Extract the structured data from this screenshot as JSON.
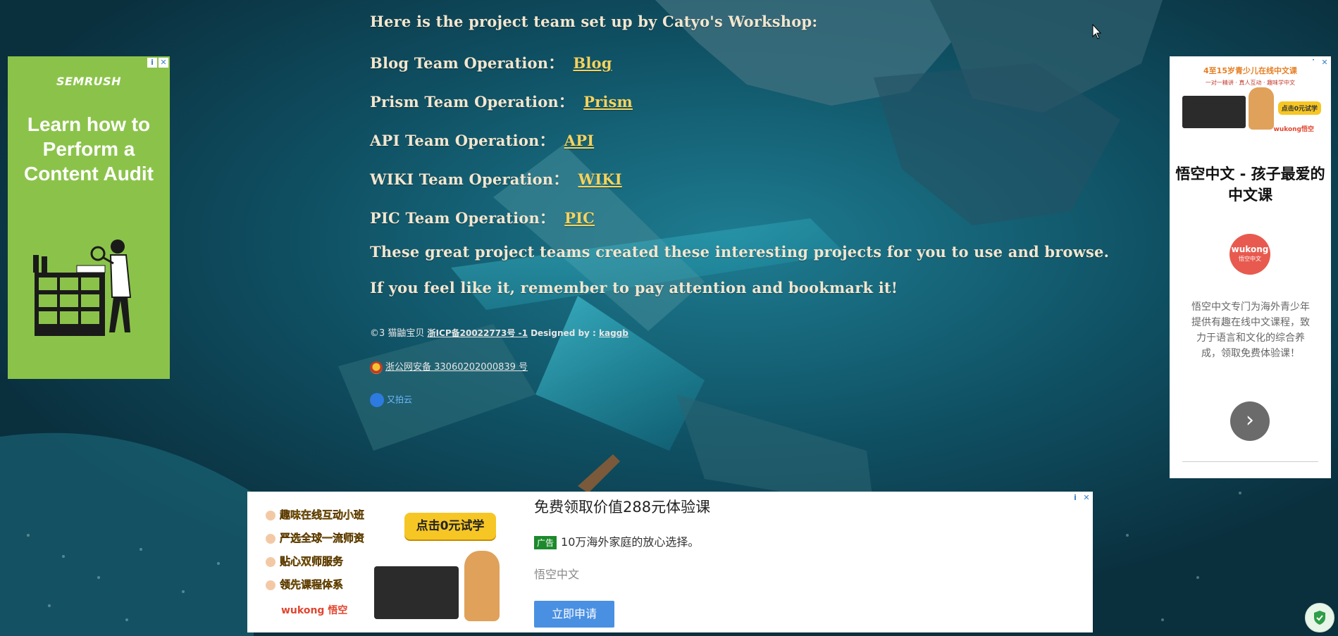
{
  "main": {
    "intro": "Here is the project team set up by Catyo's Workshop:",
    "teams": [
      {
        "label": "Blog Team Operation：",
        "link": "Blog"
      },
      {
        "label": "Prism Team Operation：",
        "link": "Prism"
      },
      {
        "label": "API Team Operation：",
        "link": "API"
      },
      {
        "label": "WIKI Team Operation：",
        "link": "WIKI"
      },
      {
        "label": "PIC Team Operation：",
        "link": "PIC"
      }
    ],
    "outro1": "These great project teams created these interesting projects for you to use and browse.",
    "outro2": "If you feel like it, remember to pay attention and bookmark it!"
  },
  "footer": {
    "copyright": "©3 猫鼬宝贝",
    "icp": "浙ICP备20022773号 -1",
    "designed_label": "Designed by :",
    "designer": "kaggb",
    "police": "浙公网安备 33060202000839 号",
    "cloud": "又拍云"
  },
  "ads": {
    "left": {
      "brand": "SEMRUSH",
      "headline": "Learn how to Perform a Content Audit"
    },
    "right": {
      "title": "悟空中文 - 孩子最爱的中文课",
      "logo_text": "wukong",
      "logo_sub": "悟空中文",
      "banner_top": "4至15岁青少儿在线中文课",
      "banner_tag": "一对一精讲 · 真人互动 · 趣味学中文",
      "banner_btn": "点击0元试学",
      "banner_brand": "wukong悟空",
      "desc": "悟空中文专门为海外青少年提供有趣在线中文课程，致力于语言和文化的综合养成，领取免费体验课！",
      "next": "›"
    },
    "bottom": {
      "features": [
        "趣味在线互动小班",
        "严选全球一流师资",
        "贴心双师服务",
        "领先课程体系"
      ],
      "try_button": "点击0元试学",
      "wukong": "wukong 悟空",
      "headline": "免费领取价值288元体验课",
      "tag": "广告",
      "sub": "10万海外家庭的放心选择。",
      "brand": "悟空中文",
      "apply": "立即申请"
    },
    "ad_info_icon": "i",
    "ad_close_icon": "✕"
  },
  "colors": {
    "link": "#f4d35e",
    "text": "#f2e6cf",
    "semrush_green": "#8bc34a",
    "wukong_red": "#e85a4f",
    "apply_blue": "#4a90e2"
  }
}
